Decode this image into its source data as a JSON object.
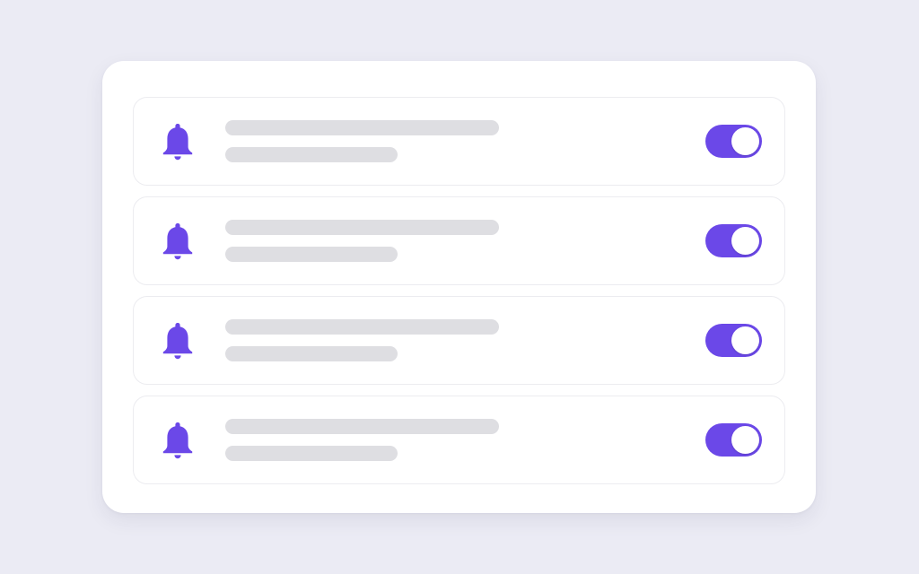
{
  "accent_color": "#6b48e8",
  "placeholder_color": "#dedee2",
  "notifications": [
    {
      "icon": "bell-icon",
      "enabled": true
    },
    {
      "icon": "bell-icon",
      "enabled": true
    },
    {
      "icon": "bell-icon",
      "enabled": true
    },
    {
      "icon": "bell-icon",
      "enabled": true
    }
  ]
}
